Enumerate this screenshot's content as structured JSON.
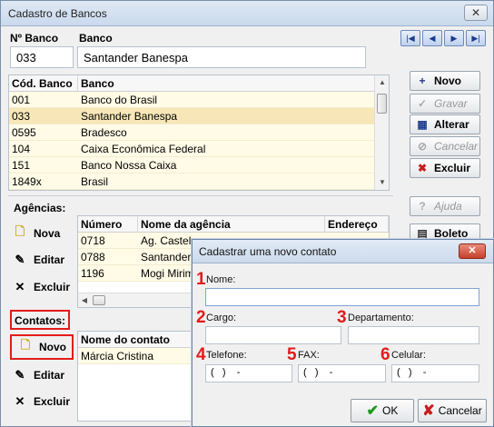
{
  "window": {
    "title": "Cadastro de Bancos",
    "close_glyph": "✕"
  },
  "header": {
    "bank_no_label": "Nº Banco",
    "bank_label": "Banco",
    "bank_no_value": "033",
    "bank_value": "Santander Banespa"
  },
  "banks_table": {
    "columns": [
      "Cód. Banco",
      "Banco"
    ],
    "rows": [
      [
        "001",
        "Banco do Brasil"
      ],
      [
        "033",
        "Santander Banespa"
      ],
      [
        "0595",
        "Bradesco"
      ],
      [
        "104",
        "Caixa Econômica Federal"
      ],
      [
        "151",
        "Banco Nossa Caixa"
      ],
      [
        "1849x",
        "Brasil"
      ]
    ],
    "selected_index": 1
  },
  "nav": {
    "first": "|◀",
    "prev": "◀",
    "next": "▶",
    "last": "▶|"
  },
  "side_buttons": {
    "novo": "Novo",
    "gravar": "Gravar",
    "alterar": "Alterar",
    "cancelar": "Cancelar",
    "excluir": "Excluir",
    "ajuda": "Ajuda",
    "boleto": "Boleto"
  },
  "agencias": {
    "section_label": "Agências:",
    "buttons": {
      "nova": "Nova",
      "editar": "Editar",
      "excluir": "Excluir"
    },
    "columns": [
      "Número",
      "Nome da agência",
      "Endereço"
    ],
    "rows": [
      [
        "0718",
        "Ag. Castelo",
        ""
      ],
      [
        "0788",
        "Santander -",
        ""
      ],
      [
        "1196",
        "Mogi Mirim",
        ""
      ]
    ]
  },
  "contatos": {
    "section_label": "Contatos:",
    "buttons": {
      "novo": "Novo",
      "editar": "Editar",
      "excluir": "Excluir"
    },
    "columns": [
      "Nome do contato"
    ],
    "rows": [
      [
        "Márcia Cristina"
      ]
    ]
  },
  "dialog": {
    "title": "Cadastrar uma novo contato",
    "close_glyph": "✕",
    "fields": {
      "nome": {
        "num": "1",
        "label": "Nome:",
        "value": ""
      },
      "cargo": {
        "num": "2",
        "label": "Cargo:",
        "value": ""
      },
      "departamento": {
        "num": "3",
        "label": "Departamento:",
        "value": ""
      },
      "telefone": {
        "num": "4",
        "label": "Telefone:",
        "value": "(   )    -"
      },
      "fax": {
        "num": "5",
        "label": "FAX:",
        "value": "(   )    -"
      },
      "celular": {
        "num": "6",
        "label": "Celular:",
        "value": "(   )    -"
      }
    },
    "ok_label": "OK",
    "cancel_label": "Cancelar"
  },
  "colors": {
    "accent_red": "#e31b1b",
    "selected_row": "#f7e7b8",
    "row_bg": "#fffbe6"
  }
}
